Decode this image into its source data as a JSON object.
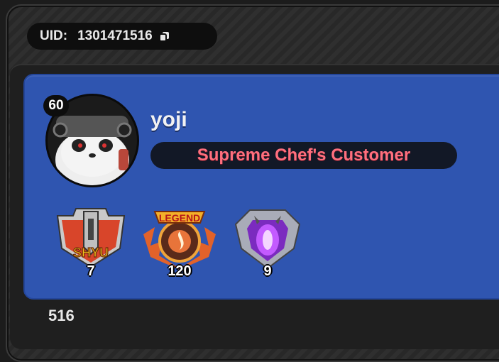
{
  "uid": {
    "label": "UID:",
    "value": "1301471516",
    "copy_icon": "copy-icon"
  },
  "profile": {
    "level": "60",
    "username": "yoji",
    "title": "Supreme Chef's Customer",
    "avatar": "panda-chef-avatar"
  },
  "badges": [
    {
      "name": "shoyu-badge",
      "label": "SHYU",
      "count": "7"
    },
    {
      "name": "legend-badge",
      "label": "LEGEND",
      "count": "120"
    },
    {
      "name": "purple-shield-badge",
      "label": "",
      "count": "9"
    }
  ],
  "footer": {
    "value": "516"
  },
  "colors": {
    "card": "#2f55b0",
    "title_text": "#ff6f7e",
    "frame": "#2a2a2a"
  }
}
